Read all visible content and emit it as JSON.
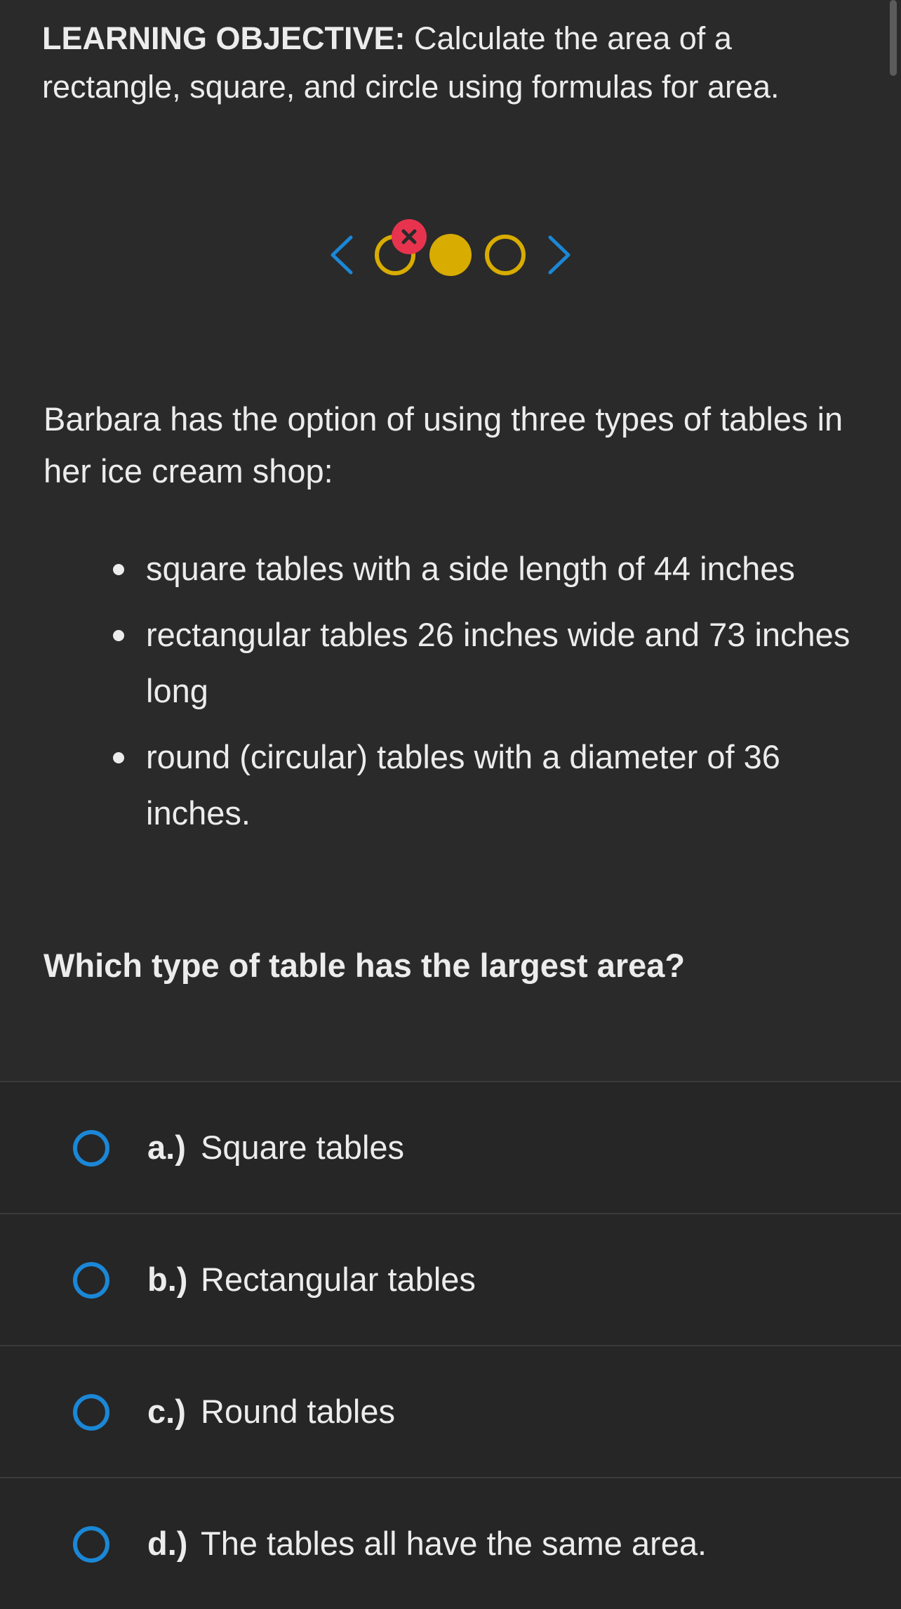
{
  "objective": {
    "label": "LEARNING OBJECTIVE:",
    "text": " Calculate the area of a rectangle, square, and circle using formulas for area."
  },
  "nav": {
    "prev_icon": "chevron-left-icon",
    "next_icon": "chevron-right-icon",
    "incorrect_badge": "×",
    "accent_blue": "#1b87d6",
    "accent_yellow": "#d8ac00",
    "accent_red": "#e8334f"
  },
  "question": {
    "intro": "Barbara has the option of using three types of tables in her ice cream shop:",
    "bullets": [
      "square tables with a side length of 44 inches",
      "rectangular tables 26 inches wide and 73 inches long",
      "round (circular) tables with a diameter of 36 inches."
    ],
    "prompt": "Which type of table has the largest area?"
  },
  "choices": [
    {
      "letter": "a.)",
      "text": "Square tables"
    },
    {
      "letter": "b.)",
      "text": "Rectangular tables"
    },
    {
      "letter": "c.)",
      "text": "Round tables"
    },
    {
      "letter": "d.)",
      "text": "The tables all have the same area."
    }
  ]
}
